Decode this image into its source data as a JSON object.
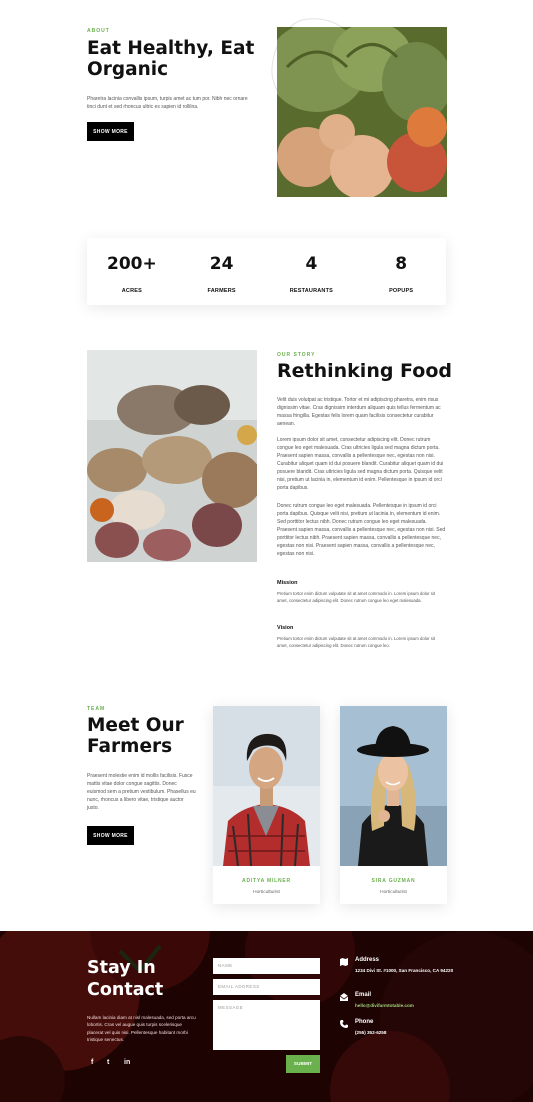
{
  "about": {
    "eyebrow": "ABOUT",
    "title": "Eat Healthy, Eat Organic",
    "text": "Pharetra lacinia convallis ipsum, turpis amet ac tum por. Nibh nec ornare tinci dunt et sed rhoncus ultric es sapien id rollilna.",
    "button": "SHOW MORE"
  },
  "stats": [
    {
      "value": "200+",
      "label": "ACRES"
    },
    {
      "value": "24",
      "label": "FARMERS"
    },
    {
      "value": "4",
      "label": "RESTAURANTS"
    },
    {
      "value": "8",
      "label": "POPUPS"
    }
  ],
  "story": {
    "eyebrow": "OUR STORY",
    "title": "Rethinking Food",
    "p1": "Velit duis volutpat ac tristique. Tortor et mi adipiscing pharetra, enim risus dignissim vitae. Cras dignissim interdum aliquam quis tellus fermentum ac massa fringilla. Egestas felis lorem quam facilisis consectetur curabitur aenean.",
    "p2": "Lorem ipsum dolor sit amet, consectetur adipiscing elit. Donec rutrum congue leo eget malesuada. Cras ultricies ligula sed magna dictum porta. Praesent sapien massa, convallis a pellentesque nec, egestas non nisi. Curabitur aliquet quam id dui posuere blandit. Curabitur aliquet quam id dui posuere blandit. Cras ultricies ligula sed magna dictum porta. Quisque velit nisi, pretium ut lacinia in, elementum id enim. Pellentesque in ipsum id orci porta dapibus.",
    "p3": "Donec rutrum congue leo eget malesuada. Pellentesque in ipsum id orci porta dapibus. Quisque velit nisi, pretium ut lacinia in, elementum id enim. Sed porttitor lectus nibh. Donec rutrum congue leo eget malesuada. Praesent sapien massa, convallis a pellentesque nec, egestas non nisi. Sed porttitor lectus nibh. Praesent sapien massa, convallis a pellentesque nec, egestas non nisi. Praesent sapien massa, convallis a pellentesque nec, egestas non nisi.",
    "mission_head": "Mission",
    "mission_text": "Pretium tortor enim dictum vulputate sit at amet commodo in. Lorem ipsum dolor sit amet, consectetur adipiscing elit. Donec rutrum congue leo eget malesuada.",
    "vision_head": "Vision",
    "vision_text": "Pretium tortor enim dictum vulputate sit at amet commodo in. Lorem ipsum dolor sit amet, consectetur adipiscing elit. Donec rutrum congue leo."
  },
  "team": {
    "eyebrow": "TEAM",
    "title": "Meet Our Farmers",
    "text": "Praesent molestie enim id mollis facilisis. Fusce mattis vitae dolor congue sagittis. Donec euismod sem a pretium vestibulum. Phasellus eu nunc, rhoncus a libero vitae, tristique auctor justo.",
    "button": "SHOW MORE",
    "members": [
      {
        "name": "ADITYA MILNER",
        "role": "Horticulturist"
      },
      {
        "name": "SIRA GUZMAN",
        "role": "Horticulturist"
      }
    ]
  },
  "contact": {
    "title": "Stay In Contact",
    "text": "Nullam lacinia diam at nisl malesuada, sed porta arcu lobortis. Cras vel augue quis turpis scelerisque placerat vel quis nisi. Pellentesque habitant morbi tristique senectus.",
    "social": [
      "f",
      "t",
      "in"
    ],
    "fields": {
      "name": "NAME",
      "email": "EMAIL ADDRESS",
      "message": "MESSAGE"
    },
    "submit": "SUBMIT",
    "address_head": "Address",
    "address_val": "1234 Divi St. #1000, San Francisco, CA 94220",
    "email_head": "Email",
    "email_val": "hello@divifarmtotable.com",
    "phone_head": "Phone",
    "phone_val": "(255) 352-6258"
  },
  "colors": {
    "accent": "#6ab04c",
    "dark": "#000000",
    "contact_bg": "#3a0808"
  }
}
